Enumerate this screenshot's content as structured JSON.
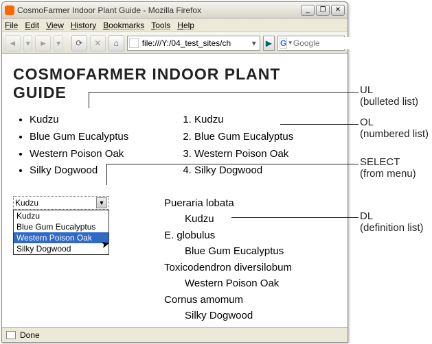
{
  "window": {
    "title": "CosmoFarmer Indoor Plant Guide - Mozilla Firefox",
    "min": "_",
    "max": "❐",
    "close": "✕"
  },
  "menu": [
    "File",
    "Edit",
    "View",
    "History",
    "Bookmarks",
    "Tools",
    "Help"
  ],
  "toolbar": {
    "back": "◄",
    "fwd": "►",
    "reload": "⟳",
    "stop": "✕",
    "home": "⌂",
    "url": "file:///Y:/04_test_sites/ch",
    "dropdown": "▾",
    "go": "▶",
    "search_icon": "G",
    "search_dd": "▾",
    "search_placeholder": "Google"
  },
  "page": {
    "heading": "COSMOFARMER INDOOR PLANT GUIDE",
    "ul_items": [
      "Kudzu",
      "Blue Gum Eucalyptus",
      "Western Poison Oak",
      "Silky Dogwood"
    ],
    "ol_items": [
      "Kudzu",
      "Blue Gum Eucalyptus",
      "Western Poison Oak",
      "Silky Dogwood"
    ],
    "select": {
      "value": "Kudzu",
      "arrow": "▼",
      "options": [
        "Kudzu",
        "Blue Gum Eucalyptus",
        "Western Poison Oak",
        "Silky Dogwood"
      ],
      "highlighted": "Western Poison Oak"
    },
    "dl": [
      {
        "dt": "Pueraria lobata",
        "dd": "Kudzu"
      },
      {
        "dt": "E. globulus",
        "dd": "Blue Gum Eucalyptus"
      },
      {
        "dt": "Toxicodendron diversilobum",
        "dd": "Western Poison Oak"
      },
      {
        "dt": "Cornus amomum",
        "dd": "Silky Dogwood"
      }
    ]
  },
  "status": {
    "text": "Done"
  },
  "annot": {
    "ul": {
      "t": "UL",
      "s": "(bulleted list)"
    },
    "ol": {
      "t": "OL",
      "s": "(numbered list)"
    },
    "select": {
      "t": "SELECT",
      "s": "(from menu)"
    },
    "dl": {
      "t": "DL",
      "s": "(definition list)"
    }
  }
}
